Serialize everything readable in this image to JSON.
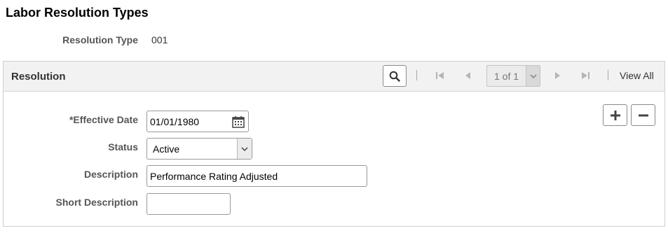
{
  "page": {
    "title": "Labor Resolution Types"
  },
  "key": {
    "label": "Resolution Type",
    "value": "001"
  },
  "panel": {
    "title": "Resolution",
    "nav": {
      "row_indicator": "1 of 1",
      "view_all": "View All"
    },
    "icons": {
      "search": "search-icon",
      "first": "first-page-icon",
      "previous": "previous-icon",
      "next": "next-icon",
      "last": "last-page-icon",
      "add": "plus-icon",
      "delete": "minus-icon",
      "calendar": "calendar-icon",
      "dropdown": "chevron-down-icon"
    },
    "fields": {
      "effective_date": {
        "label": "*Effective Date",
        "value": "01/01/1980"
      },
      "status": {
        "label": "Status",
        "value": "Active"
      },
      "description": {
        "label": "Description",
        "value": "Performance Rating Adjusted"
      },
      "short_description": {
        "label": "Short Description",
        "value": ""
      }
    }
  },
  "colors": {
    "header_bg": "#f2f2f2",
    "border": "#cfcfcf",
    "label": "#555555"
  }
}
